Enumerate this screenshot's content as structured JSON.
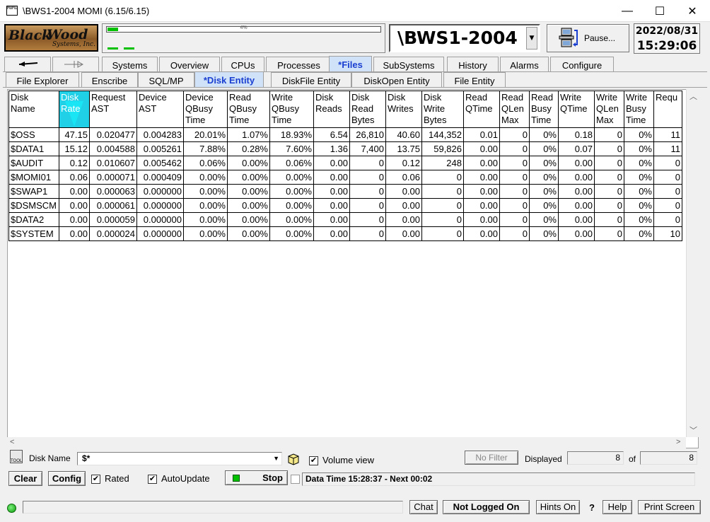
{
  "window": {
    "title": "\\BWS1-2004 MOMI (6.15/6.15)",
    "app_icon_text": "MOMI",
    "minimize": "—",
    "maximize": "☐",
    "close": "✕"
  },
  "header": {
    "logo_black": "Black",
    "logo_wood": "Wood",
    "logo_sub": "Systems, Inc.",
    "perf_label": "4%",
    "perf_fraction": 0.04,
    "system_name": "\\BWS1-2004",
    "pause_label": "Pause...",
    "date": "2022/08/31",
    "time": "15:29:06"
  },
  "main_tabs": [
    {
      "label": "Systems"
    },
    {
      "label": "Overview"
    },
    {
      "label": "CPUs"
    },
    {
      "label": "Processes"
    },
    {
      "label": "*Files",
      "active": true
    },
    {
      "label": "SubSystems"
    },
    {
      "label": "History"
    },
    {
      "label": "Alarms"
    },
    {
      "label": "Configure"
    }
  ],
  "sub_tabs": [
    {
      "label": "File Explorer"
    },
    {
      "label": "Enscribe"
    },
    {
      "label": "SQL/MP"
    },
    {
      "label": "*Disk Entity",
      "active": true
    },
    {
      "label": "DiskFile Entity"
    },
    {
      "label": "DiskOpen Entity"
    },
    {
      "label": "File Entity"
    }
  ],
  "grid": {
    "columns": [
      [
        "Disk",
        "Name"
      ],
      [
        "Disk",
        "Rate"
      ],
      [
        "Request",
        "AST"
      ],
      [
        "Device",
        "AST"
      ],
      [
        "Device",
        "QBusy",
        "Time"
      ],
      [
        "Read",
        "QBusy",
        "Time"
      ],
      [
        "Write",
        "QBusy",
        "Time"
      ],
      [
        "Disk",
        "Reads"
      ],
      [
        "Disk",
        "Read",
        "Bytes"
      ],
      [
        "Disk",
        "Writes"
      ],
      [
        "Disk",
        "Write",
        "Bytes"
      ],
      [
        "Read",
        "QTime"
      ],
      [
        "Read",
        "QLen",
        "Max"
      ],
      [
        "Read",
        "Busy",
        "Time"
      ],
      [
        "Write",
        "QTime"
      ],
      [
        "Write",
        "QLen",
        "Max"
      ],
      [
        "Write",
        "Busy",
        "Time"
      ],
      [
        "Requ"
      ]
    ],
    "rows": [
      [
        "$OSS",
        "47.15",
        "0.020477",
        "0.004283",
        "20.01%",
        "1.07%",
        "18.93%",
        "6.54",
        "26,810",
        "40.60",
        "144,352",
        "0.01",
        "0",
        "0%",
        "0.18",
        "0",
        "0%",
        "11"
      ],
      [
        "$DATA1",
        "15.12",
        "0.004588",
        "0.005261",
        "7.88%",
        "0.28%",
        "7.60%",
        "1.36",
        "7,400",
        "13.75",
        "59,826",
        "0.00",
        "0",
        "0%",
        "0.07",
        "0",
        "0%",
        "11"
      ],
      [
        "$AUDIT",
        "0.12",
        "0.010607",
        "0.005462",
        "0.06%",
        "0.00%",
        "0.06%",
        "0.00",
        "0",
        "0.12",
        "248",
        "0.00",
        "0",
        "0%",
        "0.00",
        "0",
        "0%",
        "0"
      ],
      [
        "$MOMI01",
        "0.06",
        "0.000071",
        "0.000409",
        "0.00%",
        "0.00%",
        "0.00%",
        "0.00",
        "0",
        "0.06",
        "0",
        "0.00",
        "0",
        "0%",
        "0.00",
        "0",
        "0%",
        "0"
      ],
      [
        "$SWAP1",
        "0.00",
        "0.000063",
        "0.000000",
        "0.00%",
        "0.00%",
        "0.00%",
        "0.00",
        "0",
        "0.00",
        "0",
        "0.00",
        "0",
        "0%",
        "0.00",
        "0",
        "0%",
        "0"
      ],
      [
        "$DSMSCM",
        "0.00",
        "0.000061",
        "0.000000",
        "0.00%",
        "0.00%",
        "0.00%",
        "0.00",
        "0",
        "0.00",
        "0",
        "0.00",
        "0",
        "0%",
        "0.00",
        "0",
        "0%",
        "0"
      ],
      [
        "$DATA2",
        "0.00",
        "0.000059",
        "0.000000",
        "0.00%",
        "0.00%",
        "0.00%",
        "0.00",
        "0",
        "0.00",
        "0",
        "0.00",
        "0",
        "0%",
        "0.00",
        "0",
        "0%",
        "0"
      ],
      [
        "$SYSTEM",
        "0.00",
        "0.000024",
        "0.000000",
        "0.00%",
        "0.00%",
        "0.00%",
        "0.00",
        "0",
        "0.00",
        "0",
        "0.00",
        "0",
        "0%",
        "0.00",
        "0",
        "0%",
        "10"
      ]
    ]
  },
  "filter": {
    "tool_label": "TOOL",
    "disk_name_label": "Disk Name",
    "disk_name_value": "$*",
    "volume_view_label": "Volume view",
    "volume_view_checked": true,
    "no_filter_label": "No Filter",
    "displayed_label": "Displayed",
    "displayed_value": "8",
    "of_label": "of",
    "of_value": "8"
  },
  "controls": {
    "clear_label": "Clear",
    "config_label": "Config",
    "rated_label": "Rated",
    "rated_checked": true,
    "autoupdate_label": "AutoUpdate",
    "autoupdate_checked": true,
    "stop_label": "Stop",
    "data_time": "Data Time 15:28:37 - Next 00:02"
  },
  "status": {
    "chat_label": "Chat",
    "login_label": "Not Logged On",
    "hints_label": "Hints On",
    "question_label": "?",
    "help_label": "Help",
    "print_label": "Print Screen"
  }
}
